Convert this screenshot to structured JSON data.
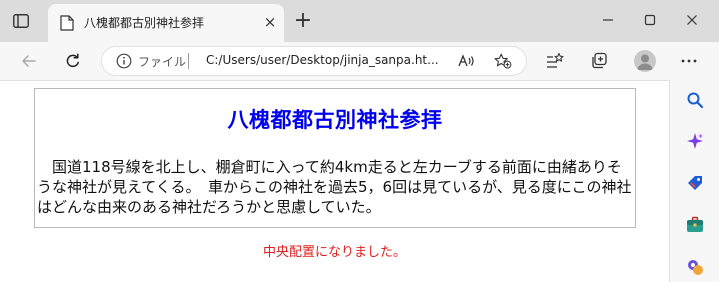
{
  "browser": {
    "tab": {
      "title": "八槐都都古別神社参拝",
      "close_label": "×"
    },
    "new_tab_label": "+",
    "address": {
      "file_label": "ファイル",
      "url": "C:/Users/user/Desktop/jinja_sanpa.ht..."
    },
    "accent_color": "#0a5fd6"
  },
  "page": {
    "title": "八槐都都古別神社参拝",
    "body": "国道118号線を北上し、棚倉町に入って約4km走ると左カーブする前面に由緒ありそうな神社が見えてくる。　車からこの神社を過去5，6回は見ているが、見る度にこの神社はどんな由来のある神社だろうかと思慮していた。",
    "caption": "中央配置になりました。",
    "title_color": "#0000ee",
    "caption_color": "#e02020"
  },
  "sidebar": {
    "items": [
      {
        "icon": "search-icon"
      },
      {
        "icon": "copilot-icon"
      },
      {
        "icon": "shopping-tag-icon"
      },
      {
        "icon": "tools-briefcase-icon"
      },
      {
        "icon": "games-icon"
      }
    ]
  }
}
